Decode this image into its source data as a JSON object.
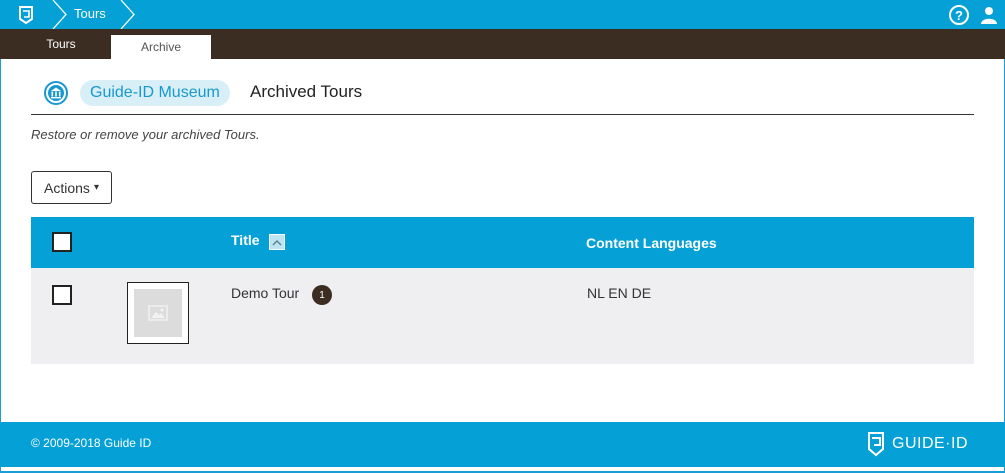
{
  "topbar": {
    "breadcrumb_label": "Tours",
    "logo_icon": "guide-id-logo-icon",
    "help_icon": "help-icon",
    "user_icon": "user-icon",
    "help_glyph": "?"
  },
  "tabs": [
    {
      "label": "Tours",
      "active": false
    },
    {
      "label": "Archive",
      "active": true
    }
  ],
  "header": {
    "museum_name": "Guide-ID Museum",
    "title": "Archived Tours",
    "subtitle": "Restore or remove your archived Tours."
  },
  "actions": {
    "label": "Actions",
    "caret": "▾"
  },
  "table": {
    "columns": [
      "Title",
      "Content Languages"
    ],
    "rows": [
      {
        "title": "Demo Tour",
        "badge": "1",
        "languages": "NL EN DE",
        "checked": false
      }
    ]
  },
  "footer": {
    "copyright": "© 2009-2018 Guide ID",
    "logo_text": "GUIDE·ID"
  },
  "colors": {
    "accent": "#05a0d5",
    "dark": "#3b2d22",
    "row_bg": "#efeef0"
  }
}
